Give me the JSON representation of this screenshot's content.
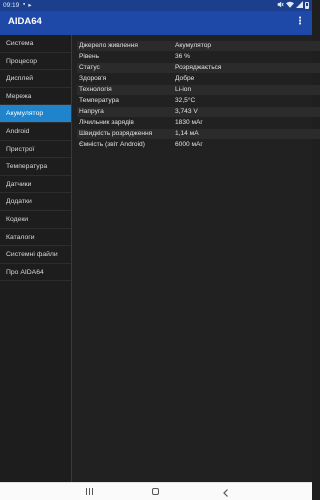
{
  "status_bar": {
    "time": "09:19",
    "notification_icons": [
      "image-icon",
      "play-icon"
    ],
    "system_icons": [
      "mute-icon",
      "wifi-icon",
      "signal-icon",
      "battery-icon"
    ]
  },
  "app_bar": {
    "title": "AIDA64",
    "menu_glyph": "⋮"
  },
  "sidebar": {
    "items": [
      {
        "label": "Система",
        "active": false
      },
      {
        "label": "Процесор",
        "active": false
      },
      {
        "label": "Дисплей",
        "active": false
      },
      {
        "label": "Мережа",
        "active": false
      },
      {
        "label": "Акумулятор",
        "active": true
      },
      {
        "label": "Android",
        "active": false
      },
      {
        "label": "Пристрої",
        "active": false
      },
      {
        "label": "Температура",
        "active": false
      },
      {
        "label": "Датчики",
        "active": false
      },
      {
        "label": "Додатки",
        "active": false
      },
      {
        "label": "Кодеки",
        "active": false
      },
      {
        "label": "Каталоги",
        "active": false
      },
      {
        "label": "Системні файли",
        "active": false
      },
      {
        "label": "Про AIDA64",
        "active": false
      }
    ]
  },
  "battery": {
    "rows": [
      {
        "key": "Джерело живлення",
        "value": "Акумулятор"
      },
      {
        "key": "Рівень",
        "value": "36 %"
      },
      {
        "key": "Статус",
        "value": "Розряджається"
      },
      {
        "key": "Здоров'я",
        "value": "Добре"
      },
      {
        "key": "Технологія",
        "value": "Li-ion"
      },
      {
        "key": "Температура",
        "value": "32,5°C"
      },
      {
        "key": "Напруга",
        "value": "3,743 V"
      },
      {
        "key": "Лічильник зарядів",
        "value": "1830 мАг"
      },
      {
        "key": "Швидкість розрядження",
        "value": "1,14 мА"
      },
      {
        "key": "Ємність (звіт Android)",
        "value": "6000 мАг"
      }
    ]
  },
  "nav_bar": {
    "buttons": [
      "recents-icon",
      "home-icon",
      "back-icon"
    ]
  },
  "colors": {
    "status_bar": "#1b3f8c",
    "app_bar": "#1e49a8",
    "active_item": "#1f84cc",
    "background": "#1f1f1f"
  }
}
